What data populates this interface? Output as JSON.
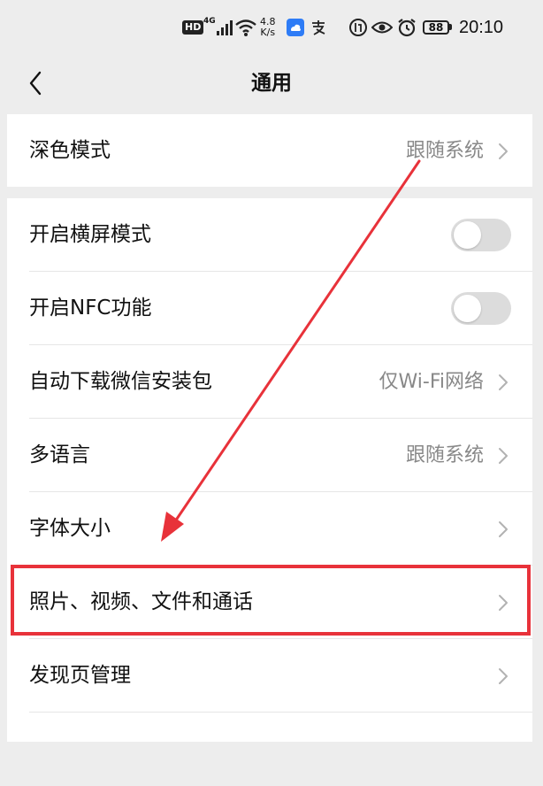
{
  "status_bar": {
    "hd": "HD",
    "signal_gen": "4G",
    "net_speed_value": "4.8",
    "net_speed_unit": "K/s",
    "battery": "88",
    "time": "20:10"
  },
  "header": {
    "title": "通用"
  },
  "settings": {
    "dark_mode": {
      "label": "深色模式",
      "value": "跟随系统"
    },
    "landscape": {
      "label": "开启横屏模式",
      "enabled": false
    },
    "nfc": {
      "label": "开启NFC功能",
      "enabled": false
    },
    "auto_download": {
      "label": "自动下载微信安装包",
      "value": "仅Wi-Fi网络"
    },
    "language": {
      "label": "多语言",
      "value": "跟随系统"
    },
    "font_size": {
      "label": "字体大小"
    },
    "media": {
      "label": "照片、视频、文件和通话"
    },
    "discover": {
      "label": "发现页管理"
    }
  },
  "colors": {
    "annotation": "#e8323a",
    "background": "#ededed",
    "row_background": "#ffffff",
    "secondary_text": "#888888"
  }
}
